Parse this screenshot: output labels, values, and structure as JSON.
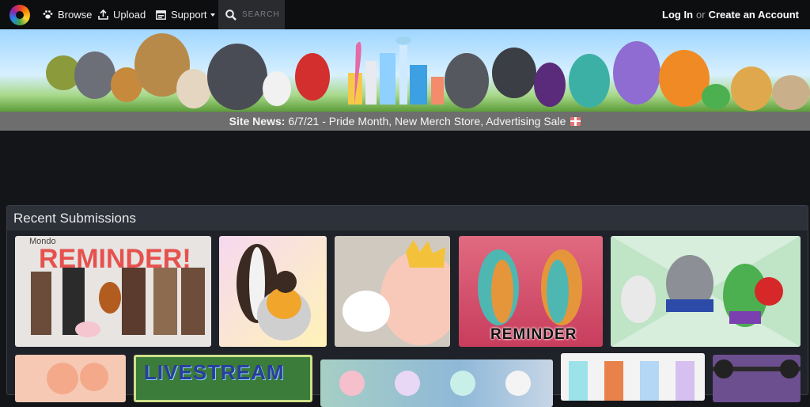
{
  "nav": {
    "browse_label": "Browse",
    "upload_label": "Upload",
    "support_label": "Support",
    "search_placeholder": "SEARCH",
    "login_label": "Log In",
    "or_text": "or",
    "create_account_label": "Create an Account"
  },
  "news": {
    "prefix": "Site News:",
    "text": "6/7/21 - Pride Month, New Merch Store, Advertising Sale"
  },
  "recent": {
    "title": "Recent Submissions",
    "items": [
      {
        "caption": "REMINDER!",
        "subtitle": "Mondo"
      },
      {
        "caption": ""
      },
      {
        "caption": ""
      },
      {
        "caption": "REMINDER"
      },
      {
        "caption": ""
      },
      {
        "caption": ""
      },
      {
        "caption": "LIVESTREAM"
      },
      {
        "caption": ""
      },
      {
        "caption": ""
      },
      {
        "caption": ""
      }
    ]
  },
  "colors": {
    "nav_bg": "#0d0e10",
    "page_bg": "#141519",
    "news_bg": "#6e6e6e",
    "panel_header_bg": "#2d3139"
  }
}
